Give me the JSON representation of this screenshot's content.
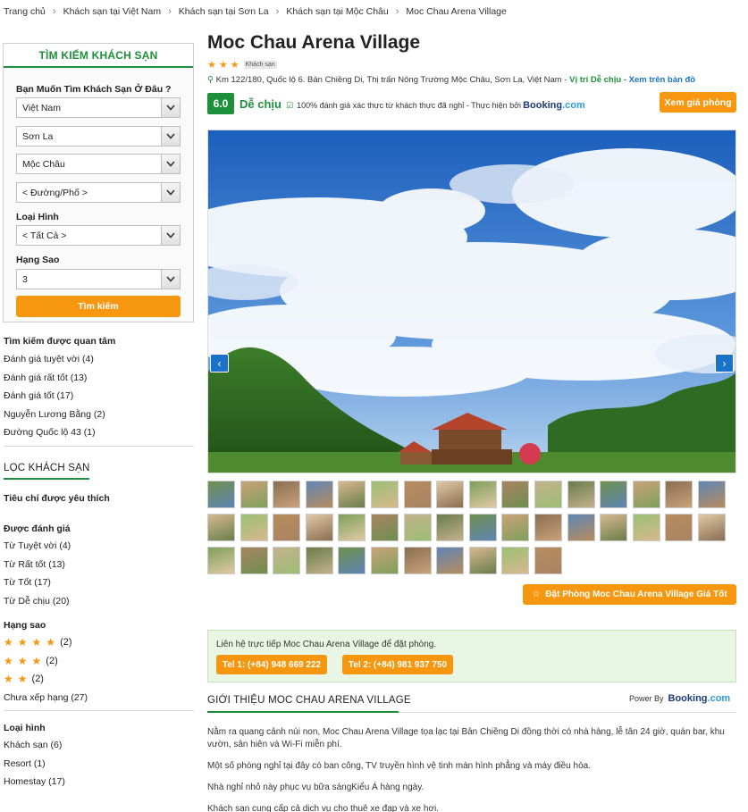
{
  "breadcrumb": [
    "Trang chủ",
    "Khách sạn tại Việt Nam",
    "Khách sạn tại Sơn La",
    "Khách sạn tại Mộc Châu",
    "Moc Chau Arena Village"
  ],
  "search": {
    "title": "TÌM KIẾM KHÁCH SẠN",
    "where_label": "Bạn Muốn Tìm Khách Sạn Ở Đâu ?",
    "country": "Việt Nam",
    "province": "Sơn La",
    "district": "Mộc Châu",
    "street": "< Đường/Phố >",
    "type_label": "Loại Hình",
    "type": "< Tất Cả >",
    "stars_label": "Hạng Sao",
    "stars": "3",
    "button": "Tìm kiếm"
  },
  "interest": {
    "title": "Tìm kiếm được quan tâm",
    "items": [
      "Đánh giá tuyệt vời (4)",
      "Đánh giá rất tốt (13)",
      "Đánh giá tốt (17)",
      "Nguyễn Lương Bằng (2)",
      "Đường Quốc lộ 43 (1)"
    ]
  },
  "filter": {
    "title": "LỌC KHÁCH SẠN",
    "favorite": "Tiêu chí được yêu thích",
    "rated_title": "Được đánh giá",
    "rated": [
      "Từ Tuyệt vời (4)",
      "Từ Rất tốt (13)",
      "Từ Tốt (17)",
      "Từ Dễ chịu (20)"
    ],
    "stars_title": "Hạng sao",
    "stars": [
      {
        "count": 4,
        "label": "(2)"
      },
      {
        "count": 3,
        "label": "(2)"
      },
      {
        "count": 2,
        "label": "(2)"
      }
    ],
    "unrated": "Chưa xếp hạng (27)",
    "type_title": "Loại hình",
    "types": [
      "Khách sạn (6)",
      "Resort (1)",
      "Homestay (17)"
    ]
  },
  "hotel": {
    "name": "Moc Chau Arena Village",
    "star_count": 3,
    "badge": "Khách sạn",
    "address": "Km 122/180, Quốc lộ 6. Bản Chiềng Di, Thị trấn Nông Trường Mộc Châu, Sơn La, Việt Nam - ",
    "location_rating": "Vị trí Dễ chịu",
    "map_link": "Xem trên bản đồ",
    "score": "6.0",
    "score_word": "Dễ chịu",
    "verify": "100% đánh giá xác thực từ khách thực đã nghỉ - Thực hiện bởi",
    "booking_brand": "Booking",
    "booking_tld": ".com",
    "price_button": "Xem giá phòng",
    "book_button": "Đặt Phòng Moc Chau Arena Village Giá Tốt",
    "thumbnail_count": 43
  },
  "contact": {
    "text": "Liên hệ trực tiếp Moc Chau Arena Village để đặt phòng.",
    "tel1": "Tel 1: (+84) 948 669 222",
    "tel2": "Tel 2: (+84) 981 937 750"
  },
  "intro": {
    "heading": "GIỚI THIỆU MOC CHAU ARENA VILLAGE",
    "power_by": "Power By",
    "paragraphs": [
      "Nằm ra quang cảnh núi non, Moc Chau Arena Village tọa lạc tại Bản Chiềng Di đồng thời có nhà hàng, lễ tân 24 giờ, quán bar, khu vườn, sân hiên và Wi-Fi miễn phí.",
      "Một số phòng nghỉ tại đây có ban công, TV truyền hình vệ tinh màn hình phẳng và máy điều hòa.",
      "Nhà nghỉ nhỏ này phục vụ bữa sángKiểu Á hàng ngày.",
      "Khách sạn cung cấp cả dịch vụ cho thuê xe đạp và xe hơi."
    ]
  },
  "colors": {
    "green": "#1e8f3a",
    "orange": "#f7960f",
    "blue": "#1a73c9"
  }
}
